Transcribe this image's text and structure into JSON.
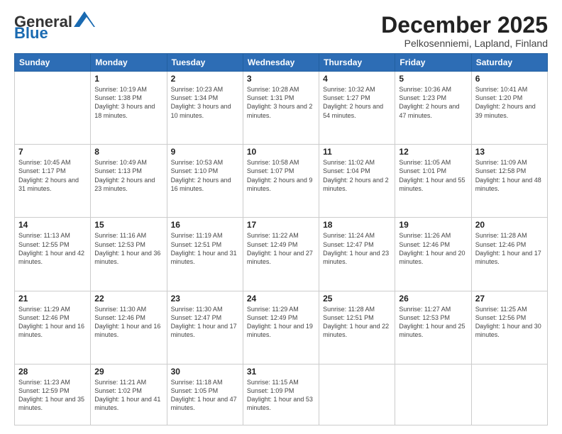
{
  "header": {
    "logo_general": "General",
    "logo_blue": "Blue",
    "title": "December 2025",
    "subtitle": "Pelkosenniemi, Lapland, Finland"
  },
  "weekdays": [
    "Sunday",
    "Monday",
    "Tuesday",
    "Wednesday",
    "Thursday",
    "Friday",
    "Saturday"
  ],
  "weeks": [
    [
      {
        "day": "",
        "info": ""
      },
      {
        "day": "1",
        "info": "Sunrise: 10:19 AM\nSunset: 1:38 PM\nDaylight: 3 hours and 18 minutes."
      },
      {
        "day": "2",
        "info": "Sunrise: 10:23 AM\nSunset: 1:34 PM\nDaylight: 3 hours and 10 minutes."
      },
      {
        "day": "3",
        "info": "Sunrise: 10:28 AM\nSunset: 1:31 PM\nDaylight: 3 hours and 2 minutes."
      },
      {
        "day": "4",
        "info": "Sunrise: 10:32 AM\nSunset: 1:27 PM\nDaylight: 2 hours and 54 minutes."
      },
      {
        "day": "5",
        "info": "Sunrise: 10:36 AM\nSunset: 1:23 PM\nDaylight: 2 hours and 47 minutes."
      },
      {
        "day": "6",
        "info": "Sunrise: 10:41 AM\nSunset: 1:20 PM\nDaylight: 2 hours and 39 minutes."
      }
    ],
    [
      {
        "day": "7",
        "info": "Sunrise: 10:45 AM\nSunset: 1:17 PM\nDaylight: 2 hours and 31 minutes."
      },
      {
        "day": "8",
        "info": "Sunrise: 10:49 AM\nSunset: 1:13 PM\nDaylight: 2 hours and 23 minutes."
      },
      {
        "day": "9",
        "info": "Sunrise: 10:53 AM\nSunset: 1:10 PM\nDaylight: 2 hours and 16 minutes."
      },
      {
        "day": "10",
        "info": "Sunrise: 10:58 AM\nSunset: 1:07 PM\nDaylight: 2 hours and 9 minutes."
      },
      {
        "day": "11",
        "info": "Sunrise: 11:02 AM\nSunset: 1:04 PM\nDaylight: 2 hours and 2 minutes."
      },
      {
        "day": "12",
        "info": "Sunrise: 11:05 AM\nSunset: 1:01 PM\nDaylight: 1 hour and 55 minutes."
      },
      {
        "day": "13",
        "info": "Sunrise: 11:09 AM\nSunset: 12:58 PM\nDaylight: 1 hour and 48 minutes."
      }
    ],
    [
      {
        "day": "14",
        "info": "Sunrise: 11:13 AM\nSunset: 12:55 PM\nDaylight: 1 hour and 42 minutes."
      },
      {
        "day": "15",
        "info": "Sunrise: 11:16 AM\nSunset: 12:53 PM\nDaylight: 1 hour and 36 minutes."
      },
      {
        "day": "16",
        "info": "Sunrise: 11:19 AM\nSunset: 12:51 PM\nDaylight: 1 hour and 31 minutes."
      },
      {
        "day": "17",
        "info": "Sunrise: 11:22 AM\nSunset: 12:49 PM\nDaylight: 1 hour and 27 minutes."
      },
      {
        "day": "18",
        "info": "Sunrise: 11:24 AM\nSunset: 12:47 PM\nDaylight: 1 hour and 23 minutes."
      },
      {
        "day": "19",
        "info": "Sunrise: 11:26 AM\nSunset: 12:46 PM\nDaylight: 1 hour and 20 minutes."
      },
      {
        "day": "20",
        "info": "Sunrise: 11:28 AM\nSunset: 12:46 PM\nDaylight: 1 hour and 17 minutes."
      }
    ],
    [
      {
        "day": "21",
        "info": "Sunrise: 11:29 AM\nSunset: 12:46 PM\nDaylight: 1 hour and 16 minutes."
      },
      {
        "day": "22",
        "info": "Sunrise: 11:30 AM\nSunset: 12:46 PM\nDaylight: 1 hour and 16 minutes."
      },
      {
        "day": "23",
        "info": "Sunrise: 11:30 AM\nSunset: 12:47 PM\nDaylight: 1 hour and 17 minutes."
      },
      {
        "day": "24",
        "info": "Sunrise: 11:29 AM\nSunset: 12:49 PM\nDaylight: 1 hour and 19 minutes."
      },
      {
        "day": "25",
        "info": "Sunrise: 11:28 AM\nSunset: 12:51 PM\nDaylight: 1 hour and 22 minutes."
      },
      {
        "day": "26",
        "info": "Sunrise: 11:27 AM\nSunset: 12:53 PM\nDaylight: 1 hour and 25 minutes."
      },
      {
        "day": "27",
        "info": "Sunrise: 11:25 AM\nSunset: 12:56 PM\nDaylight: 1 hour and 30 minutes."
      }
    ],
    [
      {
        "day": "28",
        "info": "Sunrise: 11:23 AM\nSunset: 12:59 PM\nDaylight: 1 hour and 35 minutes."
      },
      {
        "day": "29",
        "info": "Sunrise: 11:21 AM\nSunset: 1:02 PM\nDaylight: 1 hour and 41 minutes."
      },
      {
        "day": "30",
        "info": "Sunrise: 11:18 AM\nSunset: 1:05 PM\nDaylight: 1 hour and 47 minutes."
      },
      {
        "day": "31",
        "info": "Sunrise: 11:15 AM\nSunset: 1:09 PM\nDaylight: 1 hour and 53 minutes."
      },
      {
        "day": "",
        "info": ""
      },
      {
        "day": "",
        "info": ""
      },
      {
        "day": "",
        "info": ""
      }
    ]
  ]
}
